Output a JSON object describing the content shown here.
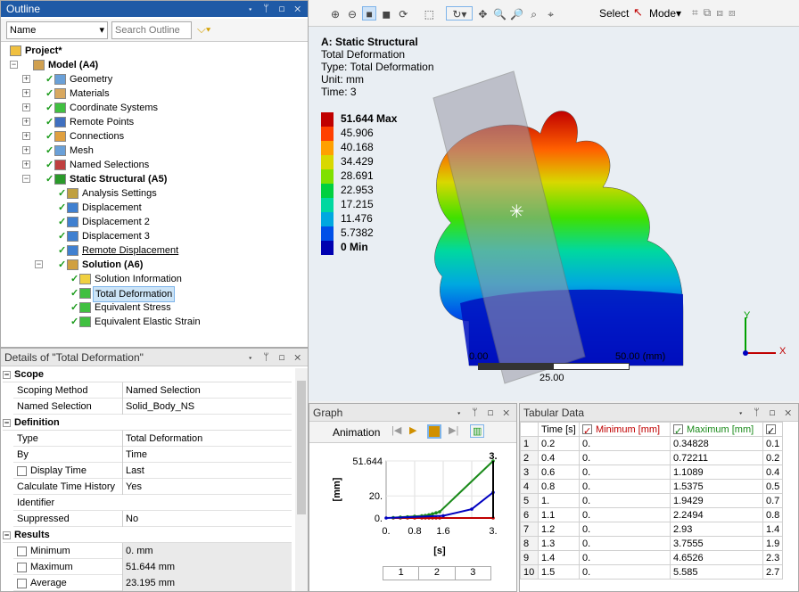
{
  "outline": {
    "title": "Outline",
    "name_dropdown": "Name",
    "search_placeholder": "Search Outline",
    "tree": [
      {
        "label": "Project*",
        "bold": true
      },
      {
        "label": "Model (A4)",
        "bold": true
      },
      {
        "label": "Geometry"
      },
      {
        "label": "Materials"
      },
      {
        "label": "Coordinate Systems"
      },
      {
        "label": "Remote Points"
      },
      {
        "label": "Connections"
      },
      {
        "label": "Mesh"
      },
      {
        "label": "Named Selections"
      },
      {
        "label": "Static Structural (A5)",
        "bold": true
      },
      {
        "label": "Analysis Settings"
      },
      {
        "label": "Displacement"
      },
      {
        "label": "Displacement 2"
      },
      {
        "label": "Displacement 3"
      },
      {
        "label": "Remote Displacement"
      },
      {
        "label": "Solution (A6)",
        "bold": true
      },
      {
        "label": "Solution Information"
      },
      {
        "label": "Total Deformation",
        "selected": true
      },
      {
        "label": "Equivalent Stress"
      },
      {
        "label": "Equivalent Elastic Strain"
      }
    ]
  },
  "details": {
    "title": "Details of \"Total Deformation\"",
    "scope_header": "Scope",
    "definition_header": "Definition",
    "results_header": "Results",
    "rows": [
      {
        "k": "Scoping Method",
        "v": "Named Selection"
      },
      {
        "k": "Named Selection",
        "v": "Solid_Body_NS"
      },
      {
        "k": "Type",
        "v": "Total Deformation"
      },
      {
        "k": "By",
        "v": "Time"
      },
      {
        "k": "Display Time",
        "v": "Last"
      },
      {
        "k": "Calculate Time History",
        "v": "Yes"
      },
      {
        "k": "Identifier",
        "v": ""
      },
      {
        "k": "Suppressed",
        "v": "No"
      },
      {
        "k": "Minimum",
        "v": "0. mm"
      },
      {
        "k": "Maximum",
        "v": "51.644 mm"
      },
      {
        "k": "Average",
        "v": "23.195 mm"
      }
    ]
  },
  "toolbar": {
    "select_label": "Select",
    "mode_label": "Mode"
  },
  "viewport": {
    "header_title": "A: Static Structural",
    "header_lines": [
      "Total Deformation",
      "Type: Total Deformation",
      "Unit: mm",
      "Time: 3"
    ],
    "legend": [
      {
        "label": "51.644 Max",
        "color": "#c00000"
      },
      {
        "label": "45.906",
        "color": "#ff4000"
      },
      {
        "label": "40.168",
        "color": "#ffa000"
      },
      {
        "label": "34.429",
        "color": "#d8d800"
      },
      {
        "label": "28.691",
        "color": "#80e000"
      },
      {
        "label": "22.953",
        "color": "#00d040"
      },
      {
        "label": "17.215",
        "color": "#00d8a0"
      },
      {
        "label": "11.476",
        "color": "#00a8e0"
      },
      {
        "label": "5.7382",
        "color": "#0050e8"
      },
      {
        "label": "0 Min",
        "color": "#0000b0"
      }
    ],
    "scale_left": "0.00",
    "scale_right": "50.00 (mm)",
    "scale_mid": "25.00",
    "axis_y": "Y",
    "axis_x": "X"
  },
  "graph": {
    "title": "Graph",
    "animation_label": "Animation",
    "ylabel": "[mm]",
    "xlabel": "[s]",
    "y_ticks": [
      "51.644",
      "20.",
      "0."
    ],
    "x_ticks": [
      "0.",
      "0.8",
      "1.6",
      "3."
    ],
    "top_label": "3.",
    "frames": [
      "1",
      "2",
      "3"
    ]
  },
  "chart_data": {
    "type": "line",
    "xlabel": "[s]",
    "ylabel": "[mm]",
    "xlim": [
      0,
      3
    ],
    "ylim": [
      0,
      51.644
    ],
    "series": [
      {
        "name": "Minimum [mm]",
        "color": "#c00000",
        "x": [
          0.2,
          0.4,
          0.6,
          0.8,
          1.0,
          1.1,
          1.2,
          1.3,
          1.4,
          1.5,
          3.0
        ],
        "values": [
          0,
          0,
          0,
          0,
          0,
          0,
          0,
          0,
          0,
          0,
          0
        ]
      },
      {
        "name": "Maximum [mm]",
        "color": "#1a8a1a",
        "x": [
          0.2,
          0.4,
          0.6,
          0.8,
          1.0,
          1.1,
          1.2,
          1.3,
          1.4,
          1.5,
          3.0
        ],
        "values": [
          0.34828,
          0.72211,
          1.1089,
          1.5375,
          1.9429,
          2.2494,
          2.93,
          3.7555,
          4.6526,
          5.585,
          51.644
        ]
      },
      {
        "color": "#0000c0",
        "x": [
          0,
          1.6,
          2.4,
          3.0
        ],
        "values": [
          0,
          2,
          8,
          23.195
        ]
      }
    ]
  },
  "tabular": {
    "title": "Tabular Data",
    "headers": [
      "Time [s]",
      "Minimum [mm]",
      "Maximum [mm]"
    ],
    "rows": [
      {
        "n": "1",
        "t": "0.2",
        "min": "0.",
        "max": "0.34828",
        "avg": "0.1"
      },
      {
        "n": "2",
        "t": "0.4",
        "min": "0.",
        "max": "0.72211",
        "avg": "0.2"
      },
      {
        "n": "3",
        "t": "0.6",
        "min": "0.",
        "max": "1.1089",
        "avg": "0.4"
      },
      {
        "n": "4",
        "t": "0.8",
        "min": "0.",
        "max": "1.5375",
        "avg": "0.5"
      },
      {
        "n": "5",
        "t": "1.",
        "min": "0.",
        "max": "1.9429",
        "avg": "0.7"
      },
      {
        "n": "6",
        "t": "1.1",
        "min": "0.",
        "max": "2.2494",
        "avg": "0.8"
      },
      {
        "n": "7",
        "t": "1.2",
        "min": "0.",
        "max": "2.93",
        "avg": "1.4"
      },
      {
        "n": "8",
        "t": "1.3",
        "min": "0.",
        "max": "3.7555",
        "avg": "1.9"
      },
      {
        "n": "9",
        "t": "1.4",
        "min": "0.",
        "max": "4.6526",
        "avg": "2.3"
      },
      {
        "n": "10",
        "t": "1.5",
        "min": "0.",
        "max": "5.585",
        "avg": "2.7"
      }
    ]
  }
}
